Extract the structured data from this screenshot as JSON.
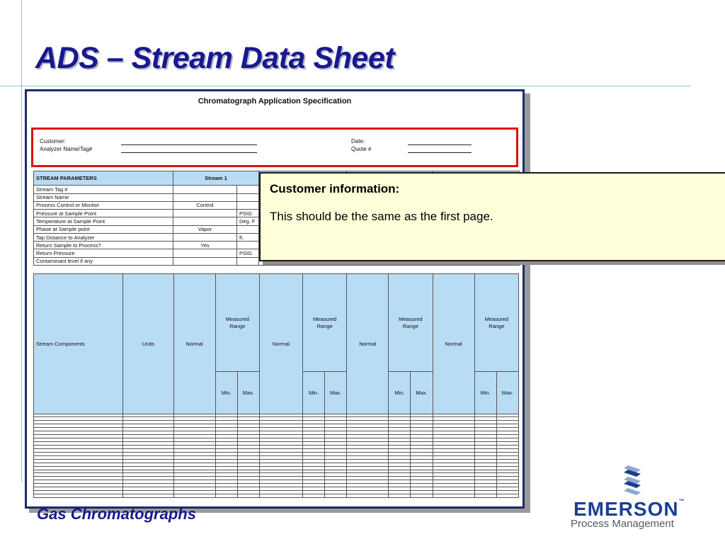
{
  "slide": {
    "title": "ADS – Stream Data Sheet",
    "footer": "Gas Chromatographs"
  },
  "doc": {
    "title": "Chromatograph Application Specification",
    "customer_label": "Customer:",
    "analyzer_label": "Analyzer Name/Tag#",
    "date_label": "Date:",
    "quote_label": "Quote #"
  },
  "params": {
    "header": "STREAM PARAMETERS",
    "stream1": "Stream 1",
    "rows": [
      {
        "label": "Stream Tag #",
        "value": "",
        "unit": ""
      },
      {
        "label": "Stream Name",
        "value": "",
        "unit": ""
      },
      {
        "label": "Process Control or Monitor",
        "value": "Control",
        "unit": ""
      },
      {
        "label": "Pressure at Sample Point",
        "value": "",
        "unit": "PSIG"
      },
      {
        "label": "Temperature at Sample Point",
        "value": "",
        "unit": "Deg. F"
      },
      {
        "label": "Phase at Sample point",
        "value": "Vapor",
        "unit": ""
      },
      {
        "label": "Tap Distance to Analyzer",
        "value": "",
        "unit": "ft."
      },
      {
        "label": "Return Sample to Process?",
        "value": "Yes",
        "unit": ""
      },
      {
        "label": "Return Pressure",
        "value": "",
        "unit": "PSIG"
      },
      {
        "label": "Contaminant level if any",
        "value": "",
        "unit": ""
      }
    ]
  },
  "components": {
    "col_components": "Stream Components",
    "col_units": "Units",
    "col_normal": "Normal",
    "col_measured_1": "Measured",
    "col_measured_2": "Range",
    "col_min": "Min.",
    "col_max": "Max."
  },
  "callout": {
    "title": "Customer information:",
    "body": "This should be the same as the first page."
  },
  "logo": {
    "brand": "EMERSON",
    "tm": "™",
    "subtitle": "Process Management",
    "colors": {
      "blue": "#1c3f94",
      "light_blue": "#8fa6cf",
      "gray": "#555a60"
    }
  },
  "colors": {
    "title": "#17198f",
    "guide": "#7fc8de",
    "header_fill": "#b9dcf5",
    "highlight_border": "#e01010",
    "callout_fill": "#ffffd9"
  }
}
